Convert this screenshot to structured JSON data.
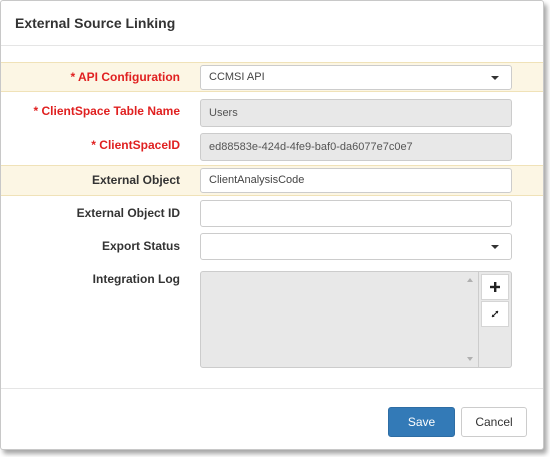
{
  "dialog": {
    "title": "External Source Linking",
    "fields": {
      "api_configuration": {
        "label": "* API Configuration",
        "value": "CCMSI API"
      },
      "table_name": {
        "label": "* ClientSpace Table Name",
        "value": "Users"
      },
      "clientspace_id": {
        "label": "* ClientSpaceID",
        "value": "ed88583e-424d-4fe9-baf0-da6077e7c0e7"
      },
      "external_object": {
        "label": "External Object",
        "value": "ClientAnalysisCode"
      },
      "external_object_id": {
        "label": "External Object ID",
        "value": ""
      },
      "export_status": {
        "label": "Export Status",
        "value": ""
      },
      "integration_log": {
        "label": "Integration Log",
        "value": ""
      }
    },
    "buttons": {
      "save": "Save",
      "cancel": "Cancel"
    }
  },
  "colors": {
    "required": "#e02020",
    "highlight_row": "#fcf6e4",
    "primary": "#337ab7"
  },
  "icons": {
    "add": "plus-icon",
    "expand": "expand-icon"
  }
}
